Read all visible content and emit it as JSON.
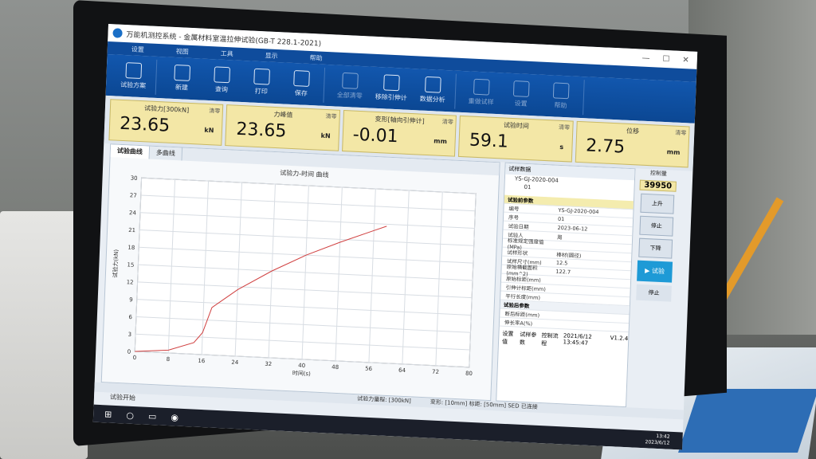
{
  "window": {
    "title": "万能机测控系统 - 金属材料室温拉伸试验(GB-T 228.1-2021)",
    "controls": [
      "—",
      "☐",
      "✕"
    ]
  },
  "menu": [
    "设置",
    "视图",
    "工具",
    "显示",
    "帮助"
  ],
  "ribbon": {
    "groups": [
      [
        {
          "label": "试验方案",
          "icon": "scheme-icon"
        }
      ],
      [
        {
          "label": "新建",
          "icon": "new-file-icon"
        },
        {
          "label": "查询",
          "icon": "query-icon"
        },
        {
          "label": "打印",
          "icon": "print-icon"
        },
        {
          "label": "保存",
          "icon": "save-icon"
        }
      ],
      [
        {
          "label": "全部清零",
          "icon": "reset-icon"
        },
        {
          "label": "移除引伸计",
          "icon": "extensometer-icon"
        },
        {
          "label": "数据分析",
          "icon": "chart-pie-icon"
        }
      ],
      [
        {
          "label": "重做试样",
          "icon": "redo-icon"
        },
        {
          "label": "设置",
          "icon": "settings-icon"
        },
        {
          "label": "帮助",
          "icon": "help-icon"
        }
      ]
    ]
  },
  "meters": [
    {
      "label": "试验力[300kN]",
      "zero": "清零",
      "value": "23.65",
      "unit": "kN"
    },
    {
      "label": "力峰值",
      "zero": "清零",
      "value": "23.65",
      "unit": "kN"
    },
    {
      "label": "变形[轴向引伸计]",
      "zero": "清零",
      "value": "-0.01",
      "unit": "mm"
    },
    {
      "label": "试验时间",
      "zero": "清零",
      "value": "59.1",
      "unit": "s"
    },
    {
      "label": "位移",
      "zero": "清零",
      "value": "2.75",
      "unit": "mm"
    }
  ],
  "chart_tabs": [
    "试验曲线",
    "多曲线"
  ],
  "chart_data": {
    "type": "line",
    "title": "试验力-时间 曲线",
    "xlabel": "时间(s)",
    "ylabel": "试验力(kN)",
    "xlim": [
      0,
      80
    ],
    "ylim": [
      0,
      30
    ],
    "xticks": [
      0,
      8,
      16,
      24,
      32,
      40,
      48,
      56,
      64,
      72,
      80
    ],
    "yticks": [
      0,
      3,
      6,
      9,
      12,
      15,
      18,
      21,
      24,
      27,
      30
    ],
    "grid": true,
    "series": [
      {
        "color": "#d04040",
        "x": [
          0,
          8,
          14,
          16,
          17,
          18,
          20,
          24,
          32,
          40,
          48,
          56,
          59
        ],
        "y": [
          0,
          0.5,
          2.0,
          3.8,
          6.0,
          8.2,
          9.3,
          11.5,
          15.0,
          18.0,
          20.5,
          22.8,
          23.65
        ]
      }
    ]
  },
  "sample": {
    "header": "试样数据",
    "id": "YS-GJ-2020-004",
    "sub": "01"
  },
  "params": {
    "section1": "试验前参数",
    "rows": [
      {
        "k": "编号",
        "v": "YS-GJ-2020-004"
      },
      {
        "k": "序号",
        "v": "01"
      },
      {
        "k": "试验日期",
        "v": "2023-06-12"
      },
      {
        "k": "试验人",
        "v": "周"
      },
      {
        "k": "标准规定强度值(MPa)",
        "v": ""
      },
      {
        "k": "试样形状",
        "v": "棒材(圆径)"
      },
      {
        "k": "试样尺寸(mm)",
        "v": "12.5"
      },
      {
        "k": "原始横截面积(mm^2)",
        "v": "122.7"
      },
      {
        "k": "原始标距(mm)",
        "v": ""
      },
      {
        "k": "引伸计标距(mm)",
        "v": ""
      },
      {
        "k": "平行长度(mm)",
        "v": ""
      }
    ],
    "section2": "试验后参数",
    "rows2": [
      {
        "k": "断后标距(mm)",
        "v": ""
      },
      {
        "k": "伸长率A(%)",
        "v": ""
      }
    ]
  },
  "bottom_tabs": [
    "设置值",
    "试样参数",
    "控制流程"
  ],
  "bottom_info": "2021/6/12 13:45:47",
  "version": "V1.2.4",
  "control": {
    "label": "控制量",
    "value": "39950",
    "up": "上升",
    "stop": "停止",
    "down": "下降",
    "run": "试验",
    "halt": "停止"
  },
  "status": {
    "force_range": "试验力量程: [300kN]",
    "deform": "变形: [10mm]  标距: [50mm]  SED 已连接"
  },
  "start_strip": "试验开始",
  "clock": {
    "time": "13:42",
    "date": "2023/6/12"
  }
}
